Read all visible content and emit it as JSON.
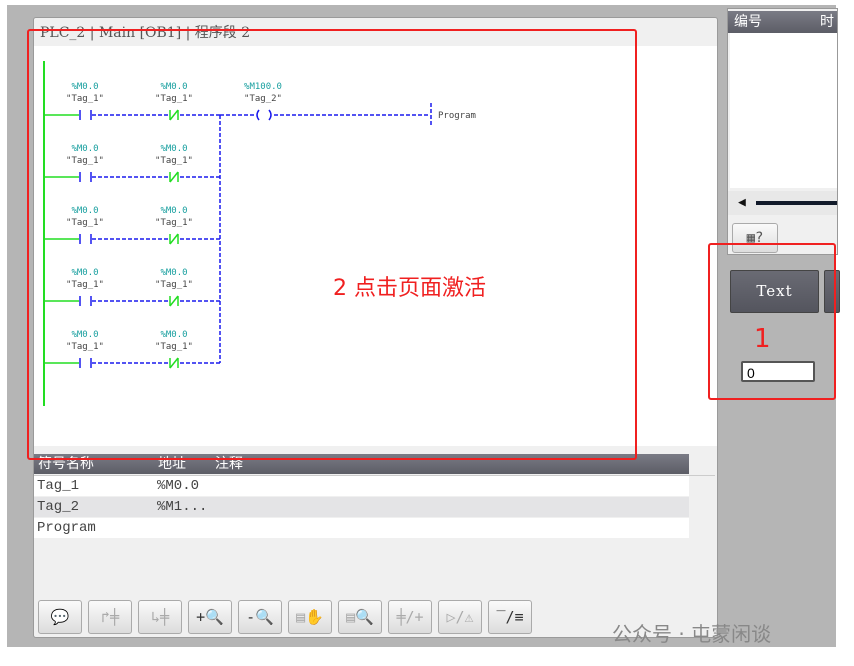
{
  "editor": {
    "breadcrumb": "PLC_2 | Main [OB1] | 程序段 2",
    "rungs": [
      {
        "c1_addr": "%M0.0",
        "c1_tag": "\"Tag_1\"",
        "c2_addr": "%M0.0",
        "c2_tag": "\"Tag_1\""
      },
      {
        "c1_addr": "%M0.0",
        "c1_tag": "\"Tag_1\"",
        "c2_addr": "%M0.0",
        "c2_tag": "\"Tag_1\""
      },
      {
        "c1_addr": "%M0.0",
        "c1_tag": "\"Tag_1\"",
        "c2_addr": "%M0.0",
        "c2_tag": "\"Tag_1\""
      },
      {
        "c1_addr": "%M0.0",
        "c1_tag": "\"Tag_1\"",
        "c2_addr": "%M0.0",
        "c2_tag": "\"Tag_1\""
      },
      {
        "c1_addr": "%M0.0",
        "c1_tag": "\"Tag_1\"",
        "c2_addr": "%M0.0",
        "c2_tag": "\"Tag_1\""
      }
    ],
    "coil": {
      "addr": "%M100.0",
      "tag": "\"Tag_2\""
    },
    "output_label": "Program",
    "colors": {
      "power_rail": "#22dd22",
      "inactive": "#1a1aee",
      "address": "#1aa0a0"
    }
  },
  "symbol_table": {
    "columns": [
      "符号名称",
      "地址",
      "注释"
    ],
    "rows": [
      {
        "name": "Tag_1",
        "address": "%M0.0",
        "comment": ""
      },
      {
        "name": "Tag_2",
        "address": "%M1...",
        "comment": ""
      },
      {
        "name": "Program",
        "address": "",
        "comment": ""
      }
    ]
  },
  "toolbar": [
    "comment-icon",
    "goto-previous-icon",
    "goto-next-icon",
    "zoom-in-icon",
    "zoom-out-icon",
    "pan-icon",
    "zoom-rect-icon",
    "insert-contact-icon",
    "status-icon",
    "network-comment-icon"
  ],
  "right_panel": {
    "columns": [
      "编号",
      "时"
    ],
    "text_button": "Text",
    "input_value": "0"
  },
  "annotations": {
    "step1": "1",
    "step2": "2 点击页面激活"
  },
  "watermark": "公众号 · 屯蒙闲谈"
}
